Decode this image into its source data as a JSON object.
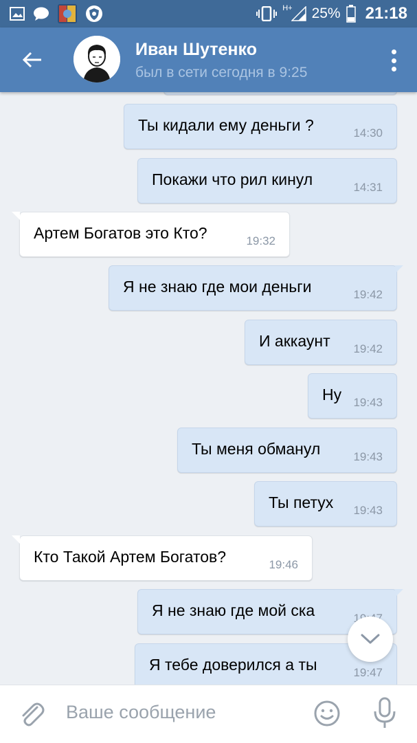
{
  "status_bar": {
    "signal_type": "H+",
    "battery": "25%",
    "time": "21:18"
  },
  "header": {
    "name": "Иван Шутенко",
    "status": "был в сети сегодня в 9:25"
  },
  "messages": [
    {
      "dir": "out",
      "text": "Ты кидали ему деньги ?",
      "time": "14:30"
    },
    {
      "dir": "out",
      "text": "Покажи что рил кинул",
      "time": "14:31"
    },
    {
      "dir": "in",
      "text": "Артем Богатов это Кто?",
      "time": "19:32"
    },
    {
      "dir": "out",
      "text": "Я не знаю где мои деньги",
      "time": "19:42"
    },
    {
      "dir": "out",
      "text": "И аккаунт",
      "time": "19:42"
    },
    {
      "dir": "out",
      "text": "Ну",
      "time": "19:43"
    },
    {
      "dir": "out",
      "text": "Ты меня обманул",
      "time": "19:43"
    },
    {
      "dir": "out",
      "text": "Ты петух",
      "time": "19:43"
    },
    {
      "dir": "in",
      "text": "Кто Такой Артем Богатов?",
      "time": "19:46"
    },
    {
      "dir": "out",
      "text": "Я не знаю где мой ска",
      "time": "19:47"
    },
    {
      "dir": "out",
      "text": "Я тебе доверился а ты",
      "time": "19:47"
    }
  ],
  "composer": {
    "placeholder": "Ваше сообщение"
  },
  "colors": {
    "header": "#5181b8",
    "status_bar": "#3f6a98",
    "background": "#edf0f4",
    "outgoing_bubble": "#d8e6f6",
    "incoming_bubble": "#ffffff"
  },
  "icons": {
    "back": "arrow-left-icon",
    "menu": "more-vertical-icon",
    "attach": "paperclip-icon",
    "emoji": "smiley-icon",
    "mic": "microphone-icon",
    "scroll": "chevron-down-icon"
  }
}
